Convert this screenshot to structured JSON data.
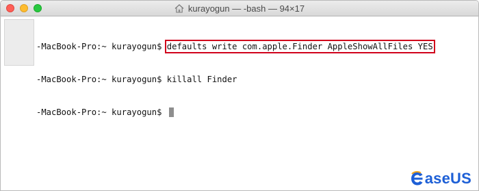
{
  "window": {
    "title": "kurayogun — -bash — 94×17",
    "title_icon": "home-folder-icon"
  },
  "terminal": {
    "lines": [
      {
        "prompt": "-MacBook-Pro:~ kurayogun$ ",
        "command": "defaults write com.apple.Finder AppleShowAllFiles YES"
      },
      {
        "prompt": "-MacBook-Pro:~ kurayogun$ ",
        "command": "killall Finder"
      },
      {
        "prompt": "-MacBook-Pro:~ kurayogun$ ",
        "command": ""
      }
    ]
  },
  "watermark": {
    "text": "aseUS"
  },
  "colors": {
    "highlight_border": "#d0021b",
    "brand": "#1d5fd6"
  }
}
